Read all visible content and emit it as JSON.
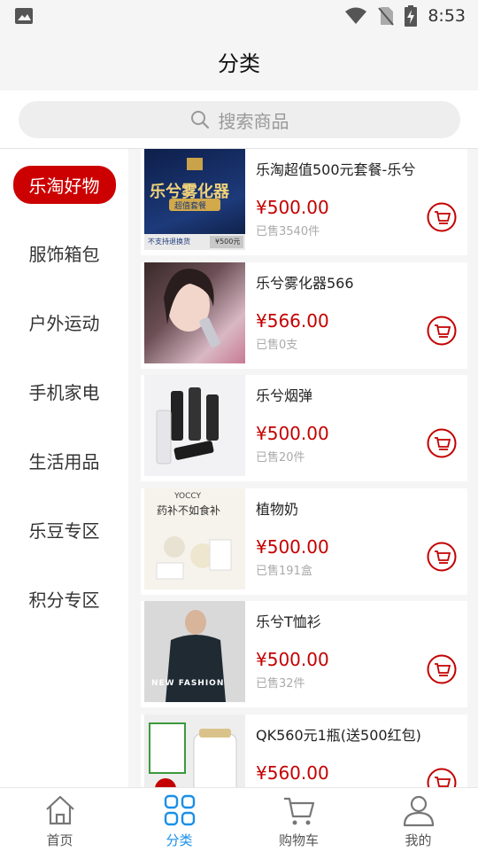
{
  "status_bar": {
    "time": "8:53"
  },
  "header": {
    "title": "分类"
  },
  "search": {
    "placeholder": "搜索商品"
  },
  "sidebar": {
    "categories": [
      {
        "label": "乐淘好物",
        "active": true
      },
      {
        "label": "服饰箱包",
        "active": false
      },
      {
        "label": "户外运动",
        "active": false
      },
      {
        "label": "手机家电",
        "active": false
      },
      {
        "label": "生活用品",
        "active": false
      },
      {
        "label": "乐豆专区",
        "active": false
      },
      {
        "label": "积分专区",
        "active": false
      }
    ]
  },
  "products": [
    {
      "name": "乐淘超值500元套餐-乐兮",
      "price": "¥500.00",
      "sold": "已售3540件",
      "image": {
        "title": "乐兮雾化器",
        "tag": "超值套餐",
        "footer_left": "不支持退换货",
        "footer_right": "¥500元"
      }
    },
    {
      "name": "乐兮雾化器566",
      "price": "¥566.00",
      "sold": "已售0支"
    },
    {
      "name": "乐兮烟弹",
      "price": "¥500.00",
      "sold": "已售20件"
    },
    {
      "name": "植物奶",
      "price": "¥500.00",
      "sold": "已售191盒",
      "image": {
        "brand": "YOCCY",
        "slogan": "药补不如食补"
      }
    },
    {
      "name": "乐兮T恤衫",
      "price": "¥500.00",
      "sold": "已售32件",
      "image": {
        "caption": "NEW FASHION"
      }
    },
    {
      "name": "QK560元1瓶(送500红包)",
      "price": "¥560.00",
      "sold": ""
    }
  ],
  "tabbar": {
    "tabs": [
      {
        "label": "首页",
        "icon": "home-icon",
        "active": false
      },
      {
        "label": "分类",
        "icon": "category-icon",
        "active": true
      },
      {
        "label": "购物车",
        "icon": "cart-icon",
        "active": false
      },
      {
        "label": "我的",
        "icon": "user-icon",
        "active": false
      }
    ]
  },
  "colors": {
    "accent_red": "#c40000",
    "active_tab_blue": "#1a8fe8"
  }
}
